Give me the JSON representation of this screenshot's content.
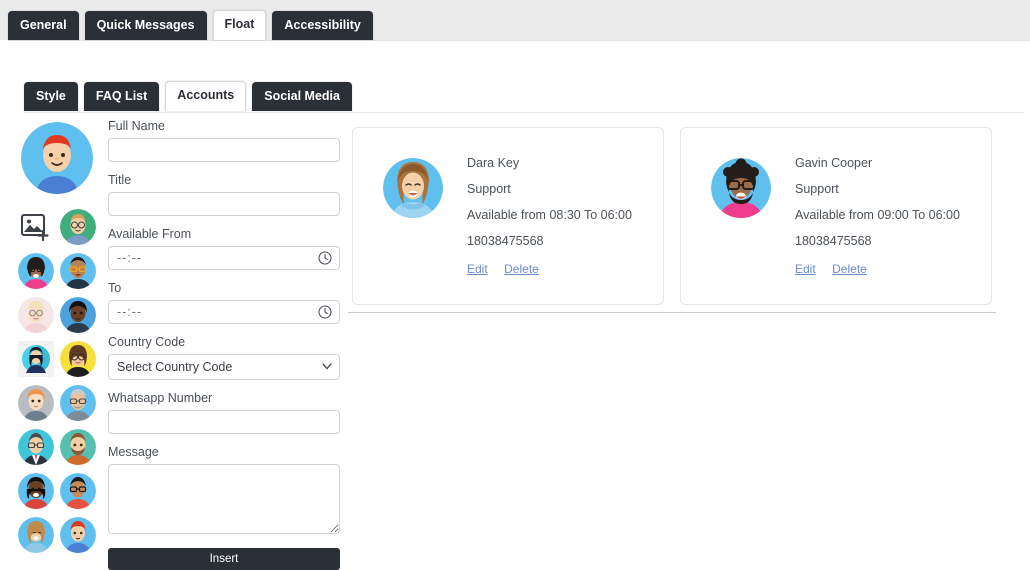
{
  "main_tabs": [
    {
      "label": "General",
      "active": false
    },
    {
      "label": "Quick Messages",
      "active": false
    },
    {
      "label": "Float",
      "active": true
    },
    {
      "label": "Accessibility",
      "active": false
    }
  ],
  "sub_tabs": [
    {
      "label": "Style",
      "active": false
    },
    {
      "label": "FAQ List",
      "active": false
    },
    {
      "label": "Accounts",
      "active": true
    },
    {
      "label": "Social Media",
      "active": false
    }
  ],
  "avatar_picker": {
    "upload_icon": "add-image-icon",
    "preview_name": "selected-avatar-preview"
  },
  "form": {
    "full_name": {
      "label": "Full Name",
      "value": "",
      "placeholder": ""
    },
    "title": {
      "label": "Title",
      "value": "",
      "placeholder": ""
    },
    "available_from": {
      "label": "Available From",
      "value": "",
      "placeholder": "--:--",
      "icon": "clock-icon"
    },
    "to": {
      "label": "To",
      "value": "",
      "placeholder": "--:--",
      "icon": "clock-icon"
    },
    "country_code": {
      "label": "Country Code",
      "selected": "Select Country Code",
      "options": [
        "Select Country Code"
      ],
      "icon": "chevron-down-icon"
    },
    "whatsapp_number": {
      "label": "Whatsapp Number",
      "value": "",
      "placeholder": ""
    },
    "message": {
      "label": "Message",
      "value": "",
      "placeholder": ""
    },
    "insert_label": "Insert"
  },
  "accounts": [
    {
      "name": "Dara Key",
      "role": "Support",
      "availability": "Available from 08:30 To 06:00",
      "phone": "18038475568",
      "edit_label": "Edit",
      "delete_label": "Delete",
      "avatar": "woman-long-hair-avatar"
    },
    {
      "name": "Gavin Cooper",
      "role": "Support",
      "availability": "Available from 09:00 To 06:00",
      "phone": "18038475568",
      "edit_label": "Edit",
      "delete_label": "Delete",
      "avatar": "bearded-man-glasses-avatar"
    }
  ],
  "colors": {
    "tab_dark": "#2b2f36",
    "top_strip": "#eaeaea",
    "link_blue": "#6a8ccc",
    "border": "#cfd3d8",
    "card_border": "#e4e6e9"
  }
}
